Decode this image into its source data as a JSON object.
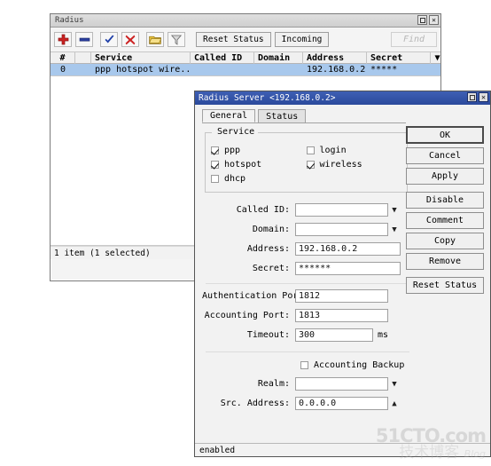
{
  "main_window": {
    "title": "Radius",
    "title_buttons": [
      {
        "name": "maximize",
        "glyph": "□"
      },
      {
        "name": "close",
        "glyph": "✕"
      }
    ],
    "toolbar": {
      "icons": [
        {
          "name": "add-icon",
          "glyph": "+",
          "color": "#cc2222"
        },
        {
          "name": "remove-icon",
          "glyph": "−",
          "color": "#2b3f9e"
        },
        {
          "name": "enable-icon",
          "glyph": "✔",
          "color": "#1f3fa8"
        },
        {
          "name": "disable-icon",
          "glyph": "✖",
          "color": "#cc2222"
        },
        {
          "name": "comment-icon",
          "glyph": "▭",
          "color": "#e8c23a"
        },
        {
          "name": "filter-icon",
          "glyph": "▽",
          "color": "#8a8a8a"
        }
      ],
      "reset_status_label": "Reset Status",
      "incoming_label": "Incoming",
      "find_placeholder": "Find"
    },
    "table": {
      "columns": [
        "#",
        "",
        "Service",
        "Called ID",
        "Domain",
        "Address",
        "Secret",
        "▼"
      ],
      "rows": [
        {
          "num": "0",
          "flag": "",
          "service": "ppp hotspot wire...",
          "called_id": "",
          "domain": "",
          "address": "192.168.0.2",
          "secret": "*****"
        }
      ]
    },
    "status": "1 item (1 selected)"
  },
  "dialog": {
    "title": "Radius Server <192.168.0.2>",
    "title_buttons": [
      {
        "name": "maximize",
        "glyph": "□"
      },
      {
        "name": "close",
        "glyph": "✕"
      }
    ],
    "tabs": [
      {
        "label": "General",
        "active": true
      },
      {
        "label": "Status",
        "active": false
      }
    ],
    "service_group": {
      "legend": "Service",
      "checkboxes": [
        {
          "label": "ppp",
          "checked": true
        },
        {
          "label": "login",
          "checked": false
        },
        {
          "label": "hotspot",
          "checked": true
        },
        {
          "label": "wireless",
          "checked": true
        },
        {
          "label": "dhcp",
          "checked": false
        }
      ]
    },
    "fields": [
      {
        "label": "Called ID:",
        "value": "",
        "widget": "combo",
        "caret": "▼"
      },
      {
        "label": "Domain:",
        "value": "",
        "widget": "combo",
        "caret": "▼"
      },
      {
        "label": "Address:",
        "value": "192.168.0.2",
        "widget": "text",
        "caret": ""
      },
      {
        "label": "Secret:",
        "value": "******",
        "widget": "text",
        "caret": ""
      }
    ],
    "fields2": [
      {
        "label": "Authentication Port:",
        "value": "1812",
        "widget": "text",
        "unit": ""
      },
      {
        "label": "Accounting Port:",
        "value": "1813",
        "widget": "text",
        "unit": ""
      },
      {
        "label": "Timeout:",
        "value": "300",
        "widget": "text",
        "unit": "ms"
      }
    ],
    "accounting_backup": {
      "label": "Accounting Backup",
      "checked": false
    },
    "fields3": [
      {
        "label": "Realm:",
        "value": "",
        "widget": "combo",
        "caret": "▼"
      },
      {
        "label": "Src. Address:",
        "value": "0.0.0.0",
        "widget": "combo",
        "caret": "▲"
      }
    ],
    "buttons": [
      {
        "label": "OK",
        "primary": true,
        "gap": false
      },
      {
        "label": "Cancel",
        "primary": false,
        "gap": false
      },
      {
        "label": "Apply",
        "primary": false,
        "gap": false
      },
      {
        "label": "Disable",
        "primary": false,
        "gap": true
      },
      {
        "label": "Comment",
        "primary": false,
        "gap": false
      },
      {
        "label": "Copy",
        "primary": false,
        "gap": false
      },
      {
        "label": "Remove",
        "primary": false,
        "gap": false
      },
      {
        "label": "Reset Status",
        "primary": false,
        "gap": true
      }
    ],
    "status": "enabled"
  },
  "watermark": {
    "line1": "51CTO.com",
    "line2": "技术博客",
    "line3": "Blog"
  },
  "colors": {
    "selection": "#a8c8ec",
    "dialog_title": "#2b4a9c",
    "accent_red": "#cc2222",
    "accent_blue": "#2b3f9e"
  }
}
